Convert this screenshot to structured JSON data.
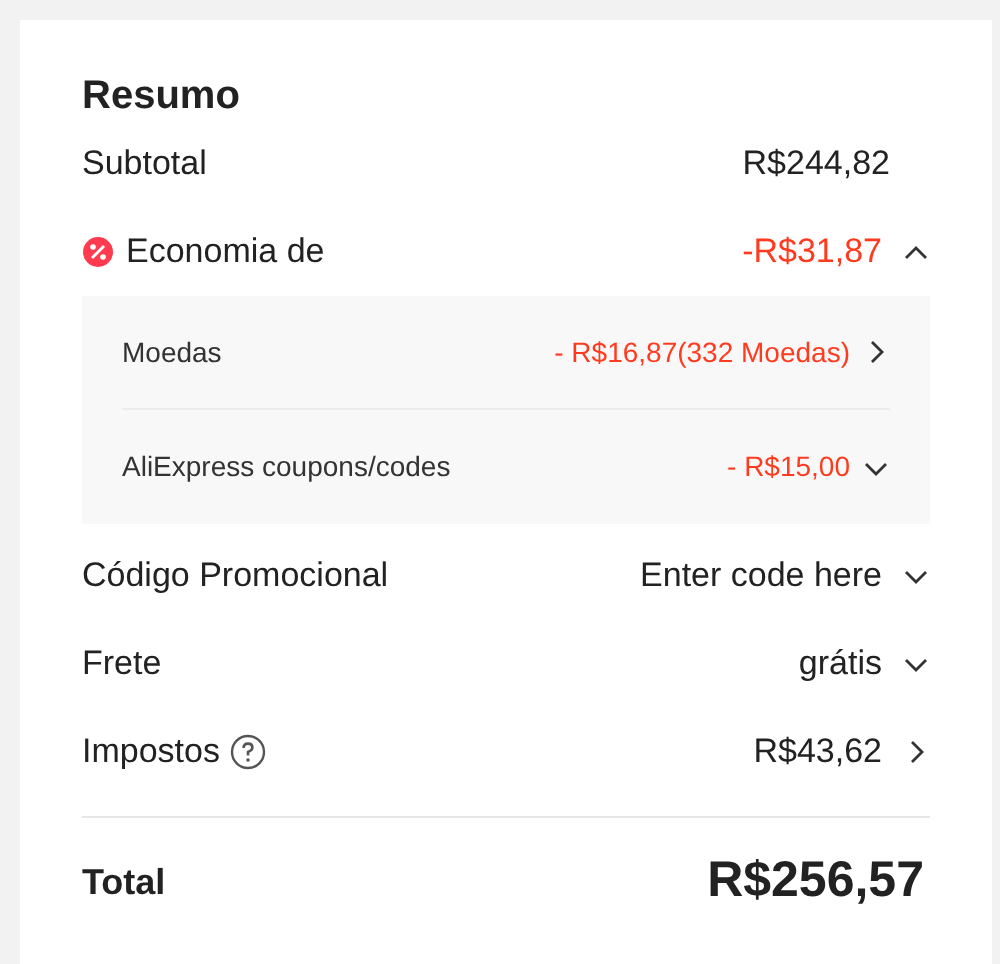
{
  "title": "Resumo",
  "subtotal": {
    "label": "Subtotal",
    "value": "R$244,82"
  },
  "savings": {
    "label": "Economia de",
    "value": "-R$31,87",
    "expanded": true,
    "items": [
      {
        "label": "Moedas",
        "value": "- R$16,87(332 Moedas)",
        "kind": "link"
      },
      {
        "label": "AliExpress coupons/codes",
        "value": "- R$15,00",
        "kind": "dropdown"
      }
    ]
  },
  "rows": [
    {
      "label": "Código Promocional",
      "value": "Enter code here",
      "kind": "dropdown",
      "help": false
    },
    {
      "label": "Frete",
      "value": "grátis",
      "kind": "dropdown",
      "help": false
    },
    {
      "label": "Impostos",
      "value": "R$43,62",
      "kind": "link",
      "help": true
    }
  ],
  "total": {
    "label": "Total",
    "value": "R$256,57"
  }
}
